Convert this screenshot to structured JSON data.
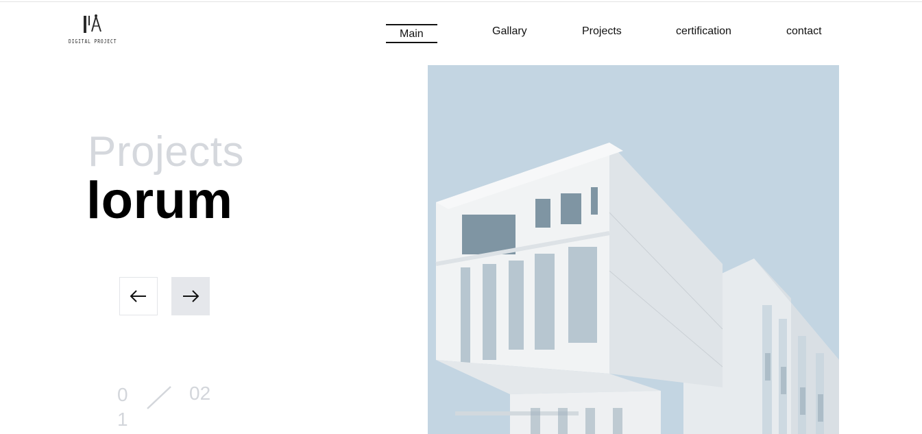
{
  "brand": {
    "logo_text": "DIGITAL PROJECT"
  },
  "nav": {
    "items": [
      {
        "label": "Main",
        "active": true
      },
      {
        "label": "Gallary",
        "active": false
      },
      {
        "label": "Projects",
        "active": false
      },
      {
        "label": "certification",
        "active": false
      },
      {
        "label": "contact",
        "active": false
      }
    ]
  },
  "hero": {
    "subtitle": "Projects",
    "title": "lorum"
  },
  "carousel": {
    "prev_icon": "arrow-left-icon",
    "next_icon": "arrow-right-icon",
    "current": "01",
    "total": "02"
  },
  "image": {
    "subject": "building-photo"
  },
  "colors": {
    "sky": "#c3d5e2",
    "muted_text": "#d5d8dd",
    "next_button_bg": "#e5e7eb"
  }
}
